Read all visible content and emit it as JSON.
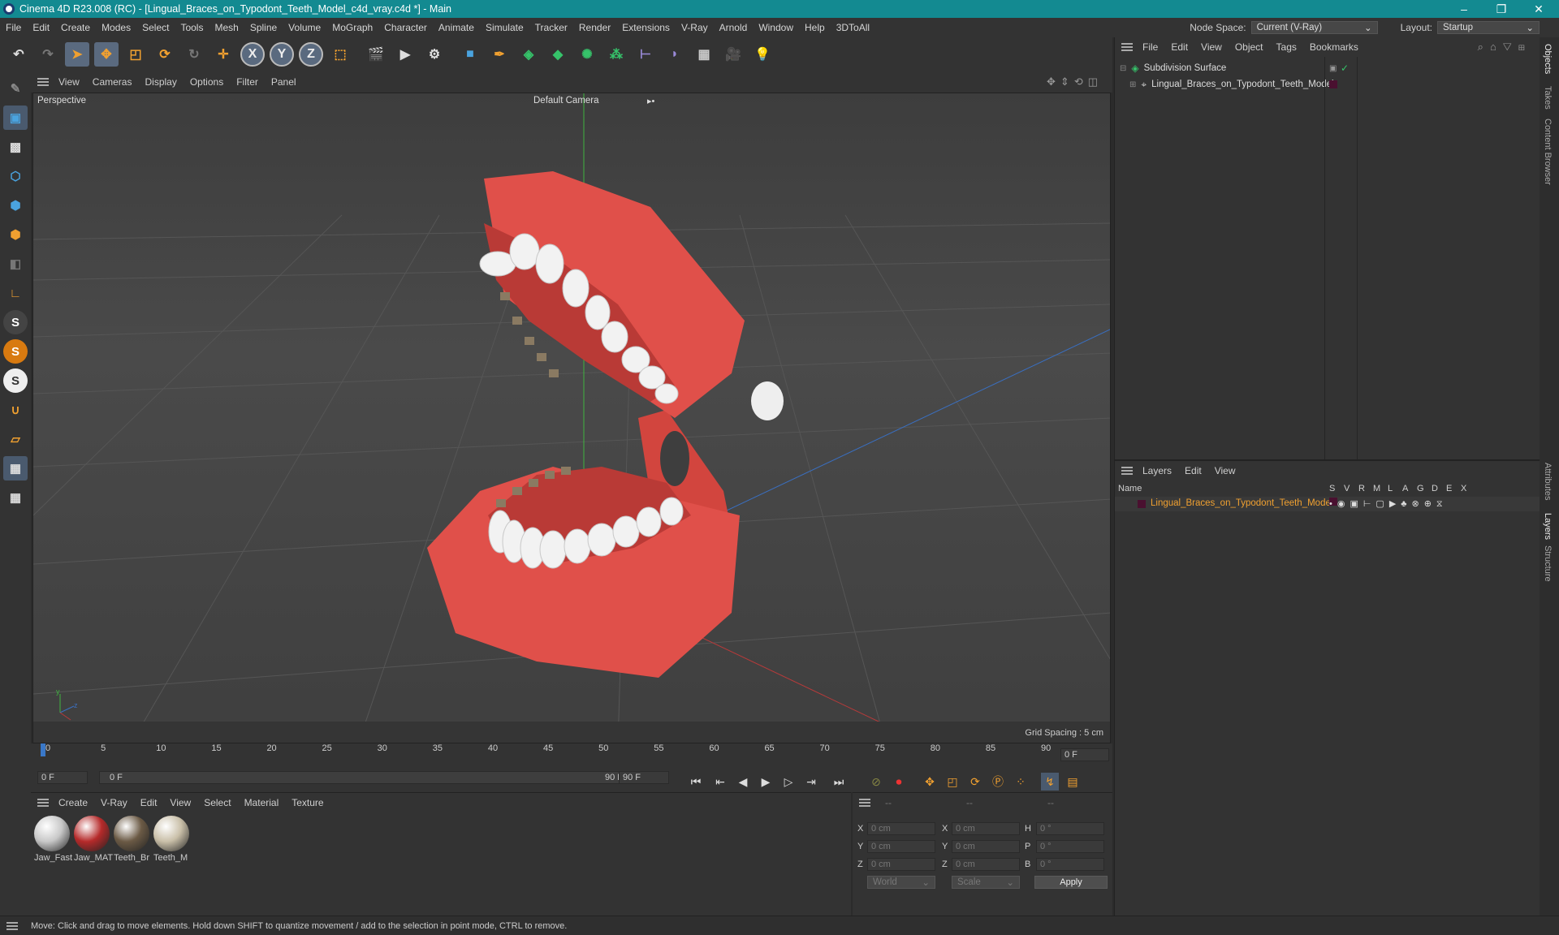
{
  "window": {
    "title": "Cinema 4D R23.008 (RC) - [Lingual_Braces_on_Typodont_Teeth_Model_c4d_vray.c4d *] - Main",
    "controls": [
      "–",
      "❐",
      "✕"
    ]
  },
  "menubar": {
    "items": [
      "File",
      "Edit",
      "Create",
      "Modes",
      "Select",
      "Tools",
      "Mesh",
      "Spline",
      "Volume",
      "MoGraph",
      "Character",
      "Animate",
      "Simulate",
      "Tracker",
      "Render",
      "Extensions",
      "V-Ray",
      "Arnold",
      "Window",
      "Help",
      "3DToAll"
    ],
    "node_space_label": "Node Space:",
    "node_space_value": "Current (V-Ray)",
    "layout_label": "Layout:",
    "layout_value": "Startup"
  },
  "toolbar": {
    "icons": [
      "undo-icon",
      "redo-icon",
      "select-arrow-icon",
      "move-icon",
      "scale-icon",
      "rotate-icon",
      "recent-tools-icon",
      "add-icon",
      "x-axis-icon",
      "y-axis-icon",
      "z-axis-icon",
      "coord-system-icon",
      "render-region-icon",
      "render-view-icon",
      "render-settings-icon",
      "cube-icon",
      "pen-icon",
      "subdivision-icon",
      "extrude-icon",
      "array-icon",
      "mograph-cloner-icon",
      "symmetry-icon",
      "deformer-icon",
      "floor-icon",
      "camera-icon",
      "light-icon"
    ]
  },
  "viewport": {
    "menu": [
      "View",
      "Cameras",
      "Display",
      "Options",
      "Filter",
      "Panel"
    ],
    "label": "Perspective",
    "camera": "Default Camera",
    "grid_spacing": "Grid Spacing : 5 cm"
  },
  "timeline": {
    "ticks": [
      "0",
      "5",
      "10",
      "15",
      "20",
      "25",
      "30",
      "35",
      "40",
      "45",
      "50",
      "55",
      "60",
      "65",
      "70",
      "75",
      "80",
      "85",
      "90"
    ],
    "current_frame": "0 F",
    "start_frame": "0 F",
    "range_start": "0 F",
    "range_end": "90 F",
    "end_frame": "90 F"
  },
  "materials": {
    "menu": [
      "Create",
      "V-Ray",
      "Edit",
      "View",
      "Select",
      "Material",
      "Texture"
    ],
    "items": [
      {
        "name": "Jaw_Fast",
        "color": "#c8c8c8"
      },
      {
        "name": "Jaw_MAT",
        "color": "#b52a2a"
      },
      {
        "name": "Teeth_Br",
        "color": "#6b5a45"
      },
      {
        "name": "Teeth_M",
        "color": "#c9bfa8"
      }
    ]
  },
  "coords": {
    "header": [
      "--",
      "--",
      "--"
    ],
    "rows": [
      {
        "a": "X",
        "av": "0 cm",
        "b": "X",
        "bv": "0 cm",
        "c": "H",
        "cv": "0 °"
      },
      {
        "a": "Y",
        "av": "0 cm",
        "b": "Y",
        "bv": "0 cm",
        "c": "P",
        "cv": "0 °"
      },
      {
        "a": "Z",
        "av": "0 cm",
        "b": "Z",
        "bv": "0 cm",
        "c": "B",
        "cv": "0 °"
      }
    ],
    "space": "World",
    "mode": "Scale",
    "apply": "Apply"
  },
  "objects": {
    "menu": [
      "File",
      "Edit",
      "View",
      "Object",
      "Tags",
      "Bookmarks"
    ],
    "items": [
      {
        "name": "Subdivision Surface"
      },
      {
        "name": "Lingual_Braces_on_Typodont_Teeth_Model"
      }
    ]
  },
  "layers": {
    "menu": [
      "Layers",
      "Edit",
      "View"
    ],
    "columns": [
      "Name",
      "S",
      "V",
      "R",
      "M",
      "L",
      "A",
      "G",
      "D",
      "E",
      "X"
    ],
    "items": [
      {
        "name": "Lingual_Braces_on_Typodont_Teeth_Model",
        "color": "#4a1030"
      }
    ]
  },
  "sidetabs": [
    "Objects",
    "Takes",
    "Content Browser",
    "Attributes",
    "Layers",
    "Structure"
  ],
  "status": "Move: Click and drag to move elements. Hold down SHIFT to quantize movement / add to the selection in point mode, CTRL to remove."
}
